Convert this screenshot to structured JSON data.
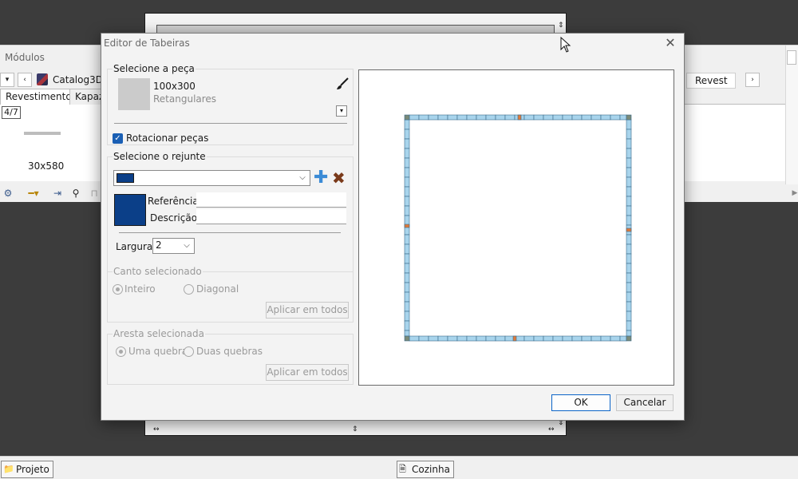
{
  "background": {
    "panel_title": "Módulos",
    "catalog_label": "Catalog3D",
    "right_tab": "Revest",
    "tabs": [
      {
        "label": "Revestimentos",
        "active": true
      },
      {
        "label": "Kapazi",
        "active": false
      }
    ],
    "pager": "4/7",
    "thumb_label": "30x580",
    "status_items": [
      {
        "label": "Projeto"
      },
      {
        "label": "Cozinha"
      }
    ]
  },
  "dialog": {
    "title": "Editor de Tabeiras",
    "close_symbol": "✕",
    "piece_group": {
      "title": "Selecione a peça",
      "piece_name": "100x300",
      "piece_category": "Retangulares",
      "rotate_label": "Rotacionar peças",
      "rotate_checked": true
    },
    "grout_group": {
      "title": "Selecione o rejunte",
      "grout_color": "#0b3f88",
      "reference_label": "Referência",
      "reference_value": "",
      "description_label": "Descrição",
      "description_value": "",
      "width_label": "Largura:",
      "width_value": "2"
    },
    "corner_group": {
      "title": "Canto selecionado",
      "options": [
        "Inteiro",
        "Diagonal"
      ],
      "selected": "Inteiro",
      "apply_label": "Aplicar em todos"
    },
    "edge_group": {
      "title": "Aresta selecionada",
      "options": [
        "Uma quebra",
        "Duas quebras"
      ],
      "selected": "Uma quebra",
      "apply_label": "Aplicar em todos"
    },
    "ok_label": "OK",
    "cancel_label": "Cancelar"
  },
  "colors": {
    "tile_fill": "#a8d4ec",
    "corner_fill": "#7a8a78",
    "break_marker": "#e07a3a",
    "accent": "#1a5fb4"
  },
  "icons": [
    "brush-icon",
    "add-icon",
    "delete-icon",
    "chevron-down-icon",
    "close-icon",
    "folder-icon",
    "kitchen-icon"
  ]
}
